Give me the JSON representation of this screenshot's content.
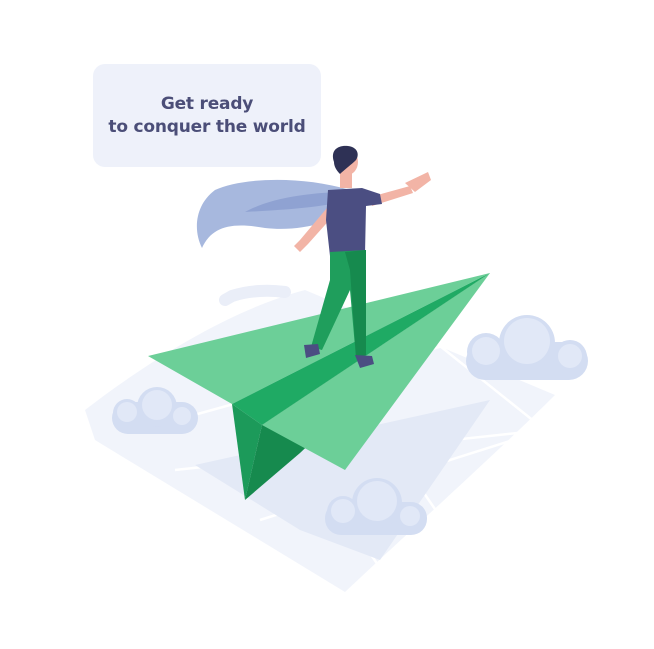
{
  "speech_bubble": {
    "line_1": "Get ready",
    "line_2": "to conquer the world"
  },
  "colors": {
    "bubble_background": "#eef1fa",
    "bubble_text": "#4b4e78",
    "ground_tile": "#f1f4fb",
    "cloud": "#d3ddf2",
    "plane_light": "#6ccf98",
    "plane_mid": "#1faa64",
    "plane_dark": "#168a4e",
    "cape": "#a7b8de",
    "shirt": "#4b4e82",
    "pants": "#1f9e5c",
    "skin": "#f2b4a6",
    "hair": "#2e3155"
  },
  "icons": [
    "paper-plane-icon",
    "superhero-person-icon",
    "cloud-icon",
    "isometric-map-tile-icon"
  ]
}
